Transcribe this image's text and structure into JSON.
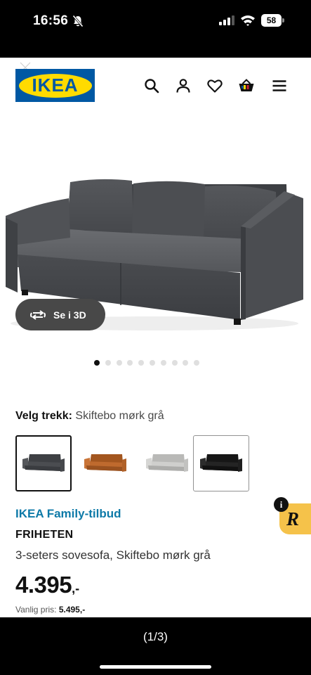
{
  "status_bar": {
    "time": "16:56",
    "battery": "58",
    "icons": [
      "bell-muted-icon",
      "cellular-signal-icon",
      "wifi-icon",
      "battery-icon"
    ]
  },
  "header": {
    "logo_text": "IKEA",
    "icons": [
      "close-icon",
      "search-icon",
      "account-icon",
      "wishlist-heart-icon",
      "cart-icon",
      "menu-icon"
    ],
    "brand_colors": {
      "blue": "#0058a3",
      "yellow": "#ffdb00"
    }
  },
  "product_image": {
    "view_3d_label": "Se i 3D",
    "carousel": {
      "total": 10,
      "active": 1
    }
  },
  "cover": {
    "label": "Velg trekk:",
    "value": "Skiftebo mørk grå",
    "options": [
      {
        "name": "Skiftebo mørk grå",
        "color": "#4b4d51",
        "selected": true
      },
      {
        "name": "orange-brown",
        "color": "#b5652c",
        "selected": false
      },
      {
        "name": "light-grey",
        "color": "#c9c9c7",
        "selected": false
      },
      {
        "name": "black",
        "color": "#202020",
        "selected": false
      }
    ]
  },
  "product": {
    "offer_label": "IKEA Family-tilbud",
    "offer_color": "#0e7aa8",
    "name": "FRIHETEN",
    "description": "3-seters sovesofa, Skiftebo mørk grå",
    "price": "4.395",
    "price_suffix": ",-",
    "regular_price_label": "Vanlig pris:",
    "regular_price_value": "5.495,-"
  },
  "overlay": {
    "info_glyph": "i",
    "badge_letter": "R"
  },
  "viewer": {
    "pager": "(1/3)"
  }
}
